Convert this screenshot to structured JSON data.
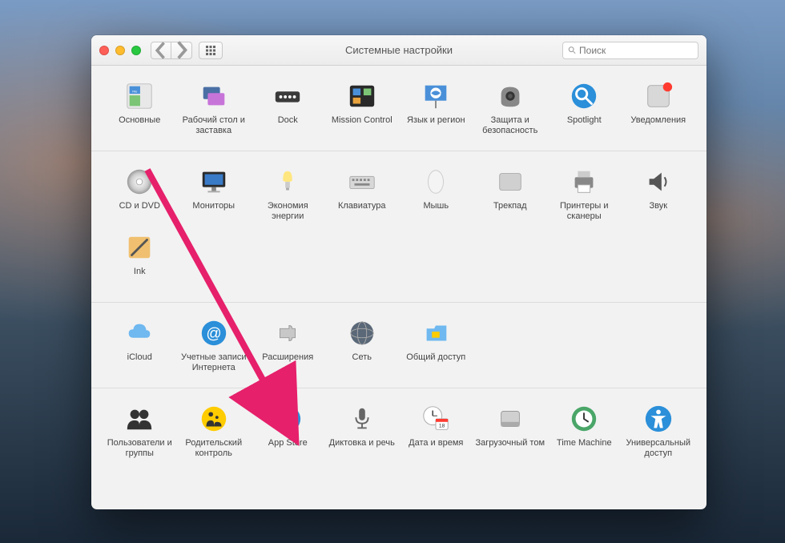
{
  "window": {
    "title": "Системные настройки",
    "search_placeholder": "Поиск"
  },
  "sections": [
    {
      "items": [
        {
          "id": "general",
          "label": "Основные"
        },
        {
          "id": "desktop",
          "label": "Рабочий стол и заставка"
        },
        {
          "id": "dock",
          "label": "Dock"
        },
        {
          "id": "mission",
          "label": "Mission Control"
        },
        {
          "id": "language",
          "label": "Язык и регион"
        },
        {
          "id": "security",
          "label": "Защита и безопасность"
        },
        {
          "id": "spotlight",
          "label": "Spotlight"
        },
        {
          "id": "notifications",
          "label": "Уведомления"
        }
      ]
    },
    {
      "items": [
        {
          "id": "cddvd",
          "label": "CD и DVD"
        },
        {
          "id": "displays",
          "label": "Мониторы"
        },
        {
          "id": "energy",
          "label": "Экономия энергии"
        },
        {
          "id": "keyboard",
          "label": "Клавиатура"
        },
        {
          "id": "mouse",
          "label": "Мышь"
        },
        {
          "id": "trackpad",
          "label": "Трекпад"
        },
        {
          "id": "printers",
          "label": "Принтеры и сканеры"
        },
        {
          "id": "sound",
          "label": "Звук"
        },
        {
          "id": "ink",
          "label": "Ink"
        }
      ]
    },
    {
      "items": [
        {
          "id": "icloud",
          "label": "iCloud"
        },
        {
          "id": "accounts",
          "label": "Учетные записи Интернета"
        },
        {
          "id": "extensions",
          "label": "Расширения"
        },
        {
          "id": "network",
          "label": "Сеть"
        },
        {
          "id": "sharing",
          "label": "Общий доступ"
        }
      ]
    },
    {
      "items": [
        {
          "id": "users",
          "label": "Пользователи и группы"
        },
        {
          "id": "parental",
          "label": "Родительский контроль"
        },
        {
          "id": "appstore",
          "label": "App Store"
        },
        {
          "id": "dictation",
          "label": "Диктовка и речь"
        },
        {
          "id": "datetime",
          "label": "Дата и время"
        },
        {
          "id": "startup",
          "label": "Загрузочный том"
        },
        {
          "id": "timemachine",
          "label": "Time Machine"
        },
        {
          "id": "accessibility",
          "label": "Универсальный доступ"
        }
      ]
    }
  ],
  "annotation": {
    "arrow_target": "appstore"
  }
}
